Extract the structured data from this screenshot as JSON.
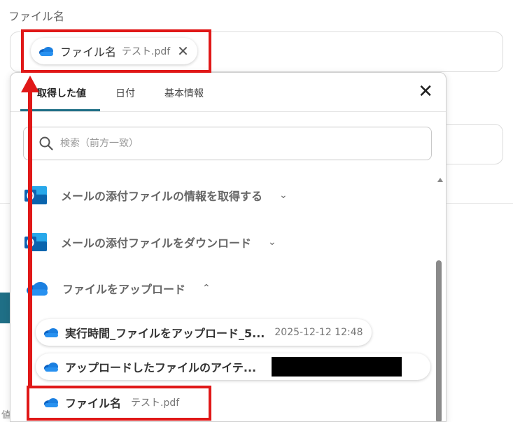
{
  "field": {
    "label": "ファイル名"
  },
  "selected_chip": {
    "name": "ファイル名",
    "value": "テスト.pdf"
  },
  "panel": {
    "tabs": [
      {
        "label": "取得した値"
      },
      {
        "label": "日付"
      },
      {
        "label": "基本情報"
      }
    ],
    "search_placeholder": "検索（前方一致）",
    "sections": [
      {
        "label": "メールの添付ファイルの情報を取得する",
        "icon": "outlook-icon",
        "expanded": false
      },
      {
        "label": "メールの添付ファイルをダウンロード",
        "icon": "outlook-icon",
        "expanded": false
      },
      {
        "label": "ファイルをアップロード",
        "icon": "onedrive-cloud-icon",
        "expanded": true
      }
    ],
    "items": [
      {
        "name": "実行時間_ファイルをアップロード_5...",
        "value": "2025-12-12 12:48"
      },
      {
        "name": "アップロードしたファイルのアイテ...",
        "value": ""
      },
      {
        "name": "ファイル名",
        "value": "テスト.pdf"
      }
    ]
  },
  "background": {
    "small_text": "値"
  },
  "colors": {
    "accent": "#1f6f86",
    "highlight": "#e01818",
    "cloud": "#1b6fc6"
  }
}
